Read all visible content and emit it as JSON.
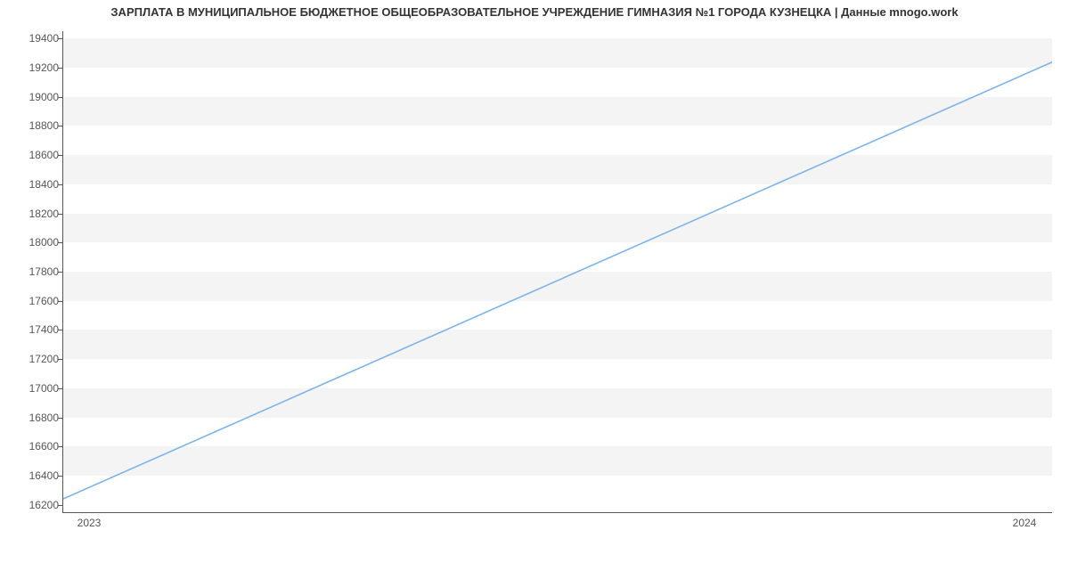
{
  "chart_data": {
    "type": "line",
    "title": "ЗАРПЛАТА В МУНИЦИПАЛЬНОЕ БЮДЖЕТНОЕ ОБЩЕОБРАЗОВАТЕЛЬНОЕ УЧРЕЖДЕНИЕ ГИМНАЗИЯ №1 ГОРОДА КУЗНЕЦКА | Данные mnogo.work",
    "xlabel": "",
    "ylabel": "",
    "x_ticks": [
      "2023",
      "2024"
    ],
    "y_ticks": [
      16200,
      16400,
      16600,
      16800,
      17000,
      17200,
      17400,
      17600,
      17800,
      18000,
      18200,
      18400,
      18600,
      18800,
      19000,
      19200,
      19400
    ],
    "ylim": [
      16150,
      19450
    ],
    "series": [
      {
        "name": "Зарплата",
        "x": [
          "2023",
          "2024"
        ],
        "values": [
          16236,
          19243
        ],
        "color": "#7cb5ec"
      }
    ]
  }
}
